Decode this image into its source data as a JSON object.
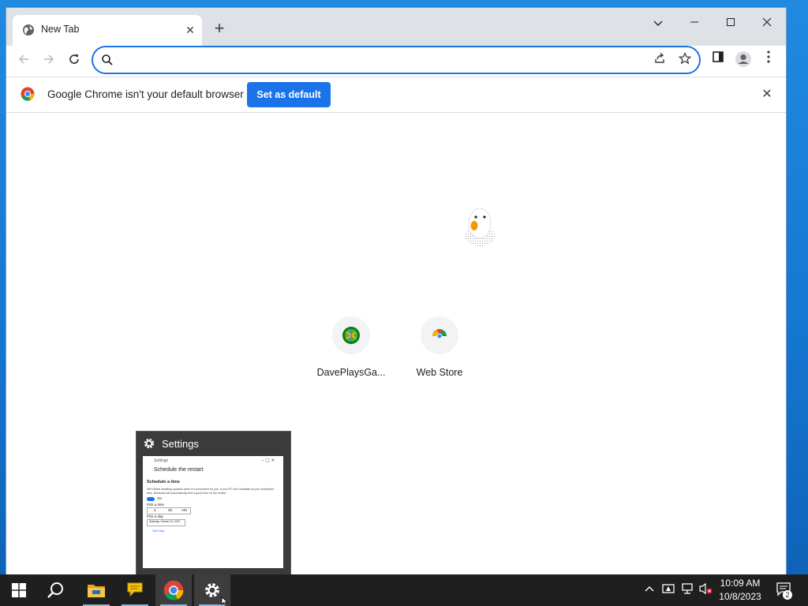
{
  "browser": {
    "tab": {
      "title": "New Tab"
    },
    "omnibox": {
      "value": "",
      "placeholder": ""
    },
    "infobar": {
      "message": "Google Chrome isn't your default browser",
      "button_label": "Set as default"
    }
  },
  "ntp": {
    "shortcuts": [
      {
        "label": "DavePlaysGa...",
        "icon": "xbox-globe-icon"
      },
      {
        "label": "Web Store",
        "icon": "chrome-web-store-icon"
      }
    ]
  },
  "preview": {
    "title": "Settings",
    "thumb": {
      "window_title": "Settings",
      "heading": "Schedule the restart",
      "subheading": "Schedule a time",
      "desc": "We'll finish installing updates when it's convenient for you. If your PC isn't available at your scheduled time, Windows will automatically find a good time for the restart.",
      "toggle_label": "On",
      "time_label": "Pick a time",
      "time_values": [
        "4",
        "30",
        "AM"
      ],
      "day_label": "Pick a day",
      "day_value": "Saturday, October 14, 2023",
      "feedback": "Get help"
    }
  },
  "taskbar": {
    "items": [
      "start-icon",
      "search-icon",
      "file-explorer-icon",
      "messenger-icon",
      "chrome-icon",
      "settings-icon"
    ],
    "clock": {
      "time": "10:09 AM",
      "date": "10/8/2023"
    },
    "notification_count": "2"
  },
  "colors": {
    "accent": "#1a73e8",
    "taskbar": "#1f1f1f",
    "desktop": "#1576cf"
  }
}
